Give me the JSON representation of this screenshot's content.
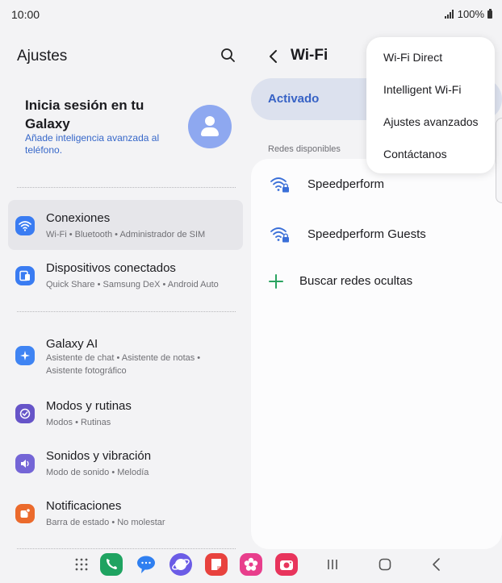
{
  "status_bar": {
    "time": "10:00",
    "battery": "100%"
  },
  "left_panel": {
    "title": "Ajustes",
    "account": {
      "title": "Inicia sesión en tu Galaxy",
      "subtitle": "Añade inteligencia avanzada al teléfono."
    },
    "items": [
      {
        "title": "Conexiones",
        "subtitle": "Wi-Fi  •  Bluetooth  •  Administrador de SIM",
        "icon": "wifi-icon",
        "color": "#3a7cf2"
      },
      {
        "title": "Dispositivos conectados",
        "subtitle": "Quick Share  •  Samsung DeX  •  Android Auto",
        "icon": "devices-icon",
        "color": "#3a7cf2"
      },
      {
        "title": "Galaxy AI",
        "subtitle": "Asistente de chat  •  Asistente de notas  •",
        "subtitle2": "Asistente fotográfico",
        "icon": "sparkle-icon",
        "color": "#3f84f3"
      },
      {
        "title": "Modos y rutinas",
        "subtitle": "Modos  •  Rutinas",
        "icon": "check-circle-icon",
        "color": "#6654c8"
      },
      {
        "title": "Sonidos y vibración",
        "subtitle": "Modo de sonido  •  Melodía",
        "icon": "volume-icon",
        "color": "#7465d6"
      },
      {
        "title": "Notificaciones",
        "subtitle": "Barra de estado  •  No molestar",
        "icon": "notification-icon",
        "color": "#eb6a2c"
      }
    ]
  },
  "right_panel": {
    "title": "Wi-Fi",
    "toggle_label": "Activado",
    "section_label": "Redes disponibles",
    "networks": [
      {
        "name": "Speedperform"
      },
      {
        "name": "Speedperform Guests"
      }
    ],
    "add_network": "Buscar redes ocultas"
  },
  "popup_menu": {
    "items": [
      "Wi-Fi Direct",
      "Intelligent Wi-Fi",
      "Ajustes avanzados",
      "Contáctanos"
    ]
  },
  "dock": {
    "apps": [
      {
        "name": "phone-app",
        "color": "#1fa361"
      },
      {
        "name": "messages-app",
        "color": "#2f7ff0"
      },
      {
        "name": "internet-app",
        "color": "#6b5ce6"
      },
      {
        "name": "notes-app",
        "color": "#e8423e"
      },
      {
        "name": "gallery-app",
        "color": "#e83e8c"
      },
      {
        "name": "camera-app",
        "color": "#e8345c"
      }
    ]
  }
}
